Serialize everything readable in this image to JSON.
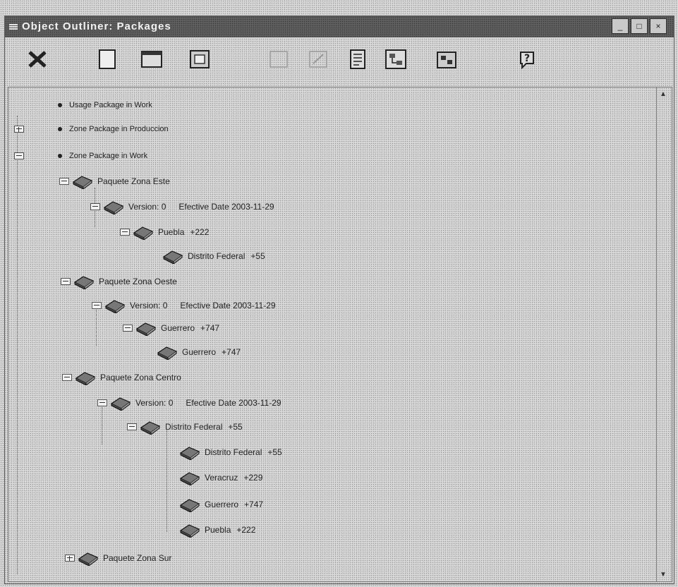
{
  "window": {
    "title": "Object Outliner: Packages",
    "controls": {
      "minimize": "_",
      "maximize": "□",
      "close": "×"
    }
  },
  "toolbar": {
    "tools": [
      {
        "icon": "close-x-icon"
      },
      {
        "icon": "new-document-icon"
      },
      {
        "icon": "open-folder-icon"
      },
      {
        "icon": "properties-icon"
      },
      {
        "icon": "disabled-tool-icon"
      },
      {
        "icon": "disabled-edit-icon"
      },
      {
        "icon": "report-icon"
      },
      {
        "icon": "diagram-icon"
      },
      {
        "icon": "hierarchy-icon"
      },
      {
        "icon": "help-icon"
      }
    ]
  },
  "tree": {
    "top_nodes": [
      {
        "label": "Usage Package in Work"
      },
      {
        "label": "Zone Package in Produccion"
      },
      {
        "label": "Zone Package in Work"
      }
    ],
    "packages": [
      {
        "name": "Paquete Zona Este",
        "version": "Version: 0",
        "date": "Efective Date 2003-11-29",
        "items": [
          {
            "name": "Puebla",
            "code": "+222"
          },
          {
            "name": "Distrito Federal",
            "code": "+55"
          }
        ]
      },
      {
        "name": "Paquete Zona Oeste",
        "version": "Version: 0",
        "date": "Efective Date 2003-11-29",
        "items": [
          {
            "name": "Guerrero",
            "code": "+747"
          },
          {
            "name": "Guerrero",
            "code": "+747"
          }
        ]
      },
      {
        "name": "Paquete Zona Centro",
        "version": "Version: 0",
        "date": "Efective Date 2003-11-29",
        "items": [
          {
            "name": "Distrito Federal",
            "code": "+55"
          },
          {
            "name": "Distrito Federal",
            "code": "+55"
          },
          {
            "name": "Veracruz",
            "code": "+229"
          },
          {
            "name": "Guerrero",
            "code": "+747"
          },
          {
            "name": "Puebla",
            "code": "+222"
          }
        ]
      },
      {
        "name": "Paquete Zona Sur"
      }
    ]
  }
}
